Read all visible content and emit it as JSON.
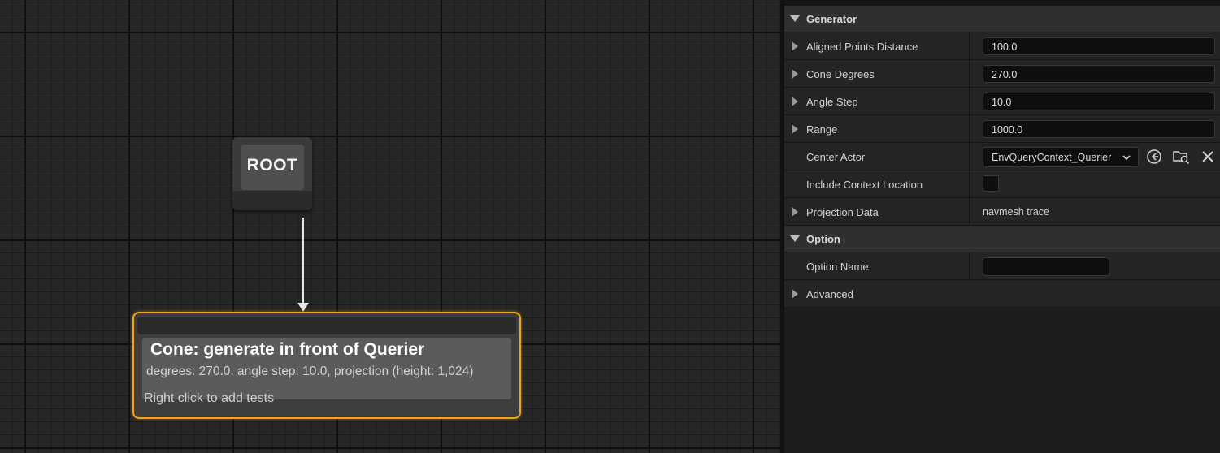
{
  "graph": {
    "root": {
      "label": "ROOT"
    },
    "generator": {
      "title": "Cone: generate in front of Querier",
      "subtitle": "degrees: 270.0, angle step: 10.0, projection (height: 1,024)",
      "footer": "Right click to add tests"
    }
  },
  "details": {
    "generator_section": {
      "title": "Generator",
      "rows": [
        {
          "label": "Aligned Points Distance",
          "value": "100.0"
        },
        {
          "label": "Cone Degrees",
          "value": "270.0"
        },
        {
          "label": "Angle Step",
          "value": "10.0"
        },
        {
          "label": "Range",
          "value": "1000.0"
        }
      ],
      "center_actor": {
        "label": "Center Actor",
        "value": "EnvQueryContext_Querier"
      },
      "include_context": {
        "label": "Include Context Location",
        "checked": false
      },
      "projection": {
        "label": "Projection Data",
        "value": "navmesh trace"
      }
    },
    "option_section": {
      "title": "Option",
      "option_name": {
        "label": "Option Name",
        "value": ""
      },
      "advanced": {
        "label": "Advanced"
      }
    }
  },
  "colors": {
    "selected_outline": "#f0a418",
    "graph_background": "#262626",
    "panel_background": "#1c1c1c"
  },
  "icons": [
    "chevron-down-icon",
    "use-selected-icon",
    "browse-asset-icon",
    "clear-icon",
    "expand-arrow-icon",
    "collapse-arrow-icon"
  ]
}
